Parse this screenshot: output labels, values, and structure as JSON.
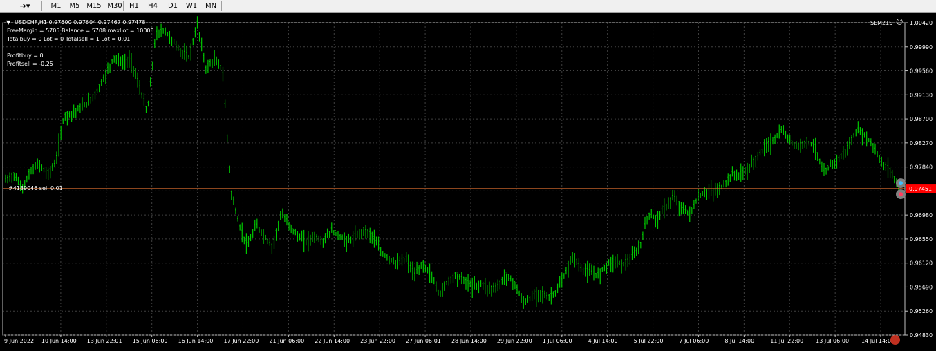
{
  "toolbar": {
    "icon_left": "cursor-icon",
    "timeframes": [
      "M1",
      "M5",
      "M15",
      "M30",
      "H1",
      "H4",
      "D1",
      "W1",
      "MN"
    ]
  },
  "chart_header": {
    "symbol_line": "USDCHF,H1  0.97600 0.97604 0.97467 0.97478",
    "indicator": "SEM21S",
    "info_lines": [
      "FreeMargin = 5705  Balance = 5708  maxLot = 10000",
      "Totalbuy = 0  Lot = 0  Totalsell = 1  Lot = 0.01",
      "",
      "Profitbuy = 0",
      "Profitsell = -0.25"
    ],
    "order_label": "#4189046 sell 0.01"
  },
  "chart_data": {
    "type": "line",
    "series": [
      {
        "values": [
          0.976,
          0.977,
          0.9745,
          0.9775,
          0.979,
          0.977,
          0.979,
          0.9875,
          0.988,
          0.989,
          0.99,
          0.992,
          0.995,
          0.998,
          0.997,
          0.9975,
          0.993,
          0.988,
          1.002,
          1.003,
          1.001,
          0.999,
          0.998,
          1.004,
          0.996,
          0.9975,
          0.996,
          0.974,
          0.968,
          0.964,
          0.968,
          0.966,
          0.964,
          0.97,
          0.968,
          0.966,
          0.965,
          0.966,
          0.965,
          0.967,
          0.966,
          0.965,
          0.966,
          0.967,
          0.966,
          0.963,
          0.962,
          0.961,
          0.962,
          0.959,
          0.961,
          0.959,
          0.9555,
          0.958,
          0.959,
          0.958,
          0.957,
          0.9575,
          0.9565,
          0.957,
          0.959,
          0.9575,
          0.954,
          0.955,
          0.956,
          0.955,
          0.956,
          0.959,
          0.9625,
          0.96,
          0.9595,
          0.959,
          0.961,
          0.9615,
          0.961,
          0.962,
          0.964,
          0.97,
          0.969,
          0.971,
          0.973,
          0.971,
          0.97,
          0.973,
          0.974,
          0.974,
          0.975,
          0.977,
          0.977,
          0.978,
          0.98,
          0.982,
          0.983,
          0.985,
          0.983,
          0.982,
          0.983,
          0.982,
          0.977,
          0.979,
          0.98,
          0.982,
          0.985,
          0.984,
          0.982,
          0.979,
          0.9778,
          0.9747
        ]
      }
    ],
    "y_ticks": [
      "1.00420",
      "0.99990",
      "0.99560",
      "0.99130",
      "0.98700",
      "0.98270",
      "0.97840",
      "0.97410",
      "0.96980",
      "0.96550",
      "0.96120",
      "0.95690",
      "0.95260",
      "0.94830"
    ],
    "x_ticks": [
      "9 Jun 2022",
      "10 Jun 14:00",
      "13 Jun 22:01",
      "15 Jun 06:00",
      "16 Jun 14:00",
      "17 Jun 22:00",
      "21 Jun 06:00",
      "22 Jun 14:00",
      "23 Jun 22:00",
      "27 Jun 06:01",
      "28 Jun 14:00",
      "29 Jun 22:00",
      "1 Jul 06:00",
      "4 Jul 14:00",
      "5 Jul 22:00",
      "7 Jul 06:00",
      "8 Jul 14:00",
      "11 Jul 22:00",
      "13 Jul 06:00",
      "14 Jul 14:00"
    ],
    "ylim": [
      0.9483,
      1.0042
    ],
    "current_price_label": "0.97451",
    "grid": true,
    "colors": {
      "bars": "#00c800",
      "grid": "#404040",
      "order_line": "#e07030",
      "price_tag": "#ff0000",
      "axis_text": "#ffffff"
    }
  }
}
